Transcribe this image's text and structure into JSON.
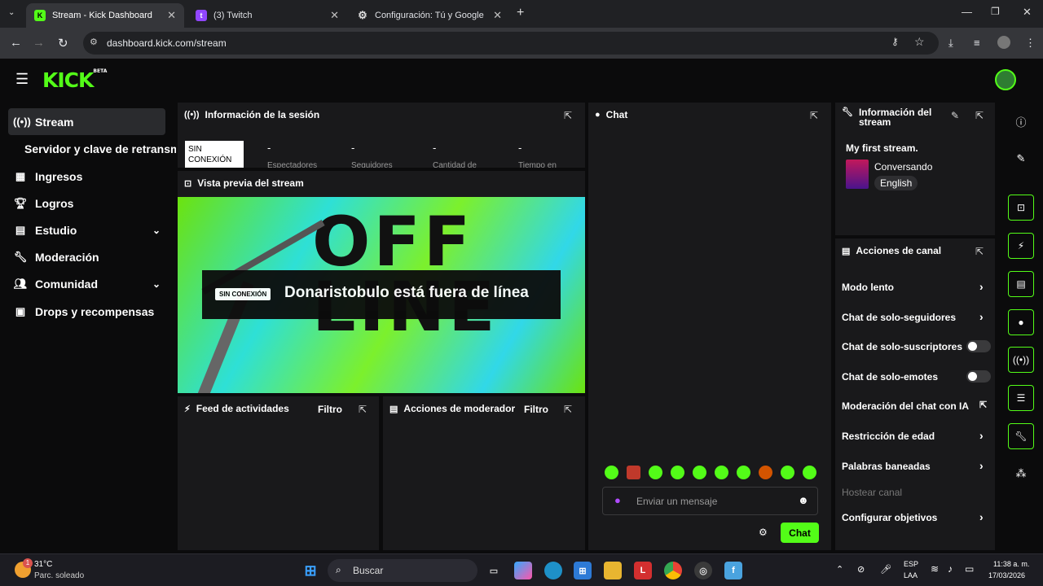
{
  "browser": {
    "tabs": [
      {
        "title": "Stream - Kick Dashboard",
        "active": true
      },
      {
        "title": "(3) Twitch",
        "active": false
      },
      {
        "title": "Configuración: Tú y Google",
        "active": false
      }
    ],
    "url": "dashboard.kick.com/stream"
  },
  "app": {
    "logo": "KICK",
    "logo_beta": "BETA"
  },
  "sidebar": {
    "items": [
      {
        "label": "Stream",
        "icon": "broadcast-icon"
      },
      {
        "label": "Servidor y clave de retransmisión"
      },
      {
        "label": "Ingresos",
        "icon": "bars-icon"
      },
      {
        "label": "Logros",
        "icon": "trophy-icon"
      },
      {
        "label": "Estudio",
        "icon": "studio-icon"
      },
      {
        "label": "Moderación",
        "icon": "wrench-icon"
      },
      {
        "label": "Comunidad",
        "icon": "people-icon"
      },
      {
        "label": "Drops y recompensas",
        "icon": "gift-icon"
      }
    ]
  },
  "session": {
    "title": "Información de la sesión",
    "offline_badge": "SIN CONEXIÓN",
    "stats": [
      {
        "value": "-",
        "label": "Espectadores"
      },
      {
        "value": "-",
        "label": "Seguidores"
      },
      {
        "value": "-",
        "label": "Cantidad de"
      },
      {
        "value": "-",
        "label": "Tiempo en"
      }
    ]
  },
  "preview": {
    "title": "Vista previa del stream",
    "offline_badge": "SIN CONEXIÓN",
    "offline_text": "Donaristobulo está fuera de línea"
  },
  "activity": {
    "title": "Feed de actividades",
    "filter": "Filtro"
  },
  "modactions": {
    "title": "Acciones de moderador",
    "filter": "Filtro"
  },
  "chat": {
    "title": "Chat",
    "placeholder": "Enviar un mensaje",
    "send_label": "Chat"
  },
  "stream_info": {
    "title": "Información del stream",
    "stream_title": "My first stream.",
    "category": "Conversando",
    "language": "English"
  },
  "channel_actions": {
    "title": "Acciones de canal",
    "items": [
      {
        "label": "Modo lento"
      },
      {
        "label": "Chat de solo-seguidores"
      },
      {
        "label": "Chat de solo-suscriptores"
      },
      {
        "label": "Chat de solo-emotes"
      },
      {
        "label": "Moderación del chat con IA"
      },
      {
        "label": "Restricción de edad"
      },
      {
        "label": "Palabras baneadas"
      },
      {
        "label": "Hostear canal"
      },
      {
        "label": "Configurar objetivos"
      }
    ]
  },
  "taskbar": {
    "weather_temp": "31°C",
    "weather_desc": "Parc. soleado",
    "search": "Buscar",
    "lang1": "ESP",
    "lang2": "LAA",
    "time": "11:38 a. m.",
    "date": "17/03/2026",
    "badge": "1"
  },
  "colors": {
    "accent": "#53fc18",
    "panel": "#19191b",
    "bg": "#0b0b0c"
  }
}
